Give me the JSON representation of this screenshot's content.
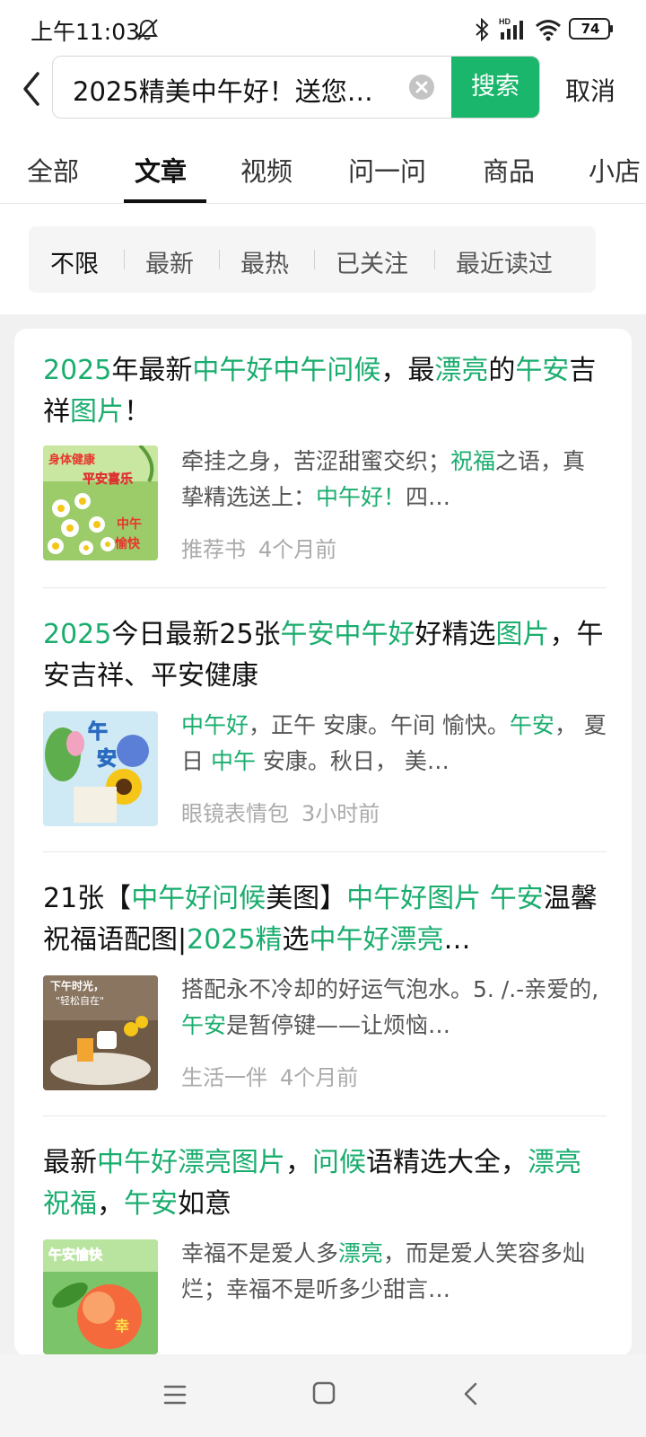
{
  "status_bar": {
    "time": "上午11:03",
    "network": "HD",
    "battery": "74"
  },
  "search": {
    "query": "2025精美中午好！送您…",
    "search_button": "搜索",
    "cancel": "取消"
  },
  "tabs": [
    {
      "label": "全部",
      "active": false
    },
    {
      "label": "文章",
      "active": true
    },
    {
      "label": "视频",
      "active": false
    },
    {
      "label": "问一问",
      "active": false
    },
    {
      "label": "商品",
      "active": false
    },
    {
      "label": "小店",
      "active": false
    }
  ],
  "filters": [
    {
      "label": "不限",
      "active": true
    },
    {
      "label": "最新",
      "active": false
    },
    {
      "label": "最热",
      "active": false
    },
    {
      "label": "已关注",
      "active": false
    },
    {
      "label": "最近读过",
      "active": false
    }
  ],
  "articles": [
    {
      "title": [
        {
          "t": "2025",
          "h": true
        },
        {
          "t": "年最新",
          "h": false
        },
        {
          "t": "中午好中午问候",
          "h": true
        },
        {
          "t": "，最",
          "h": false
        },
        {
          "t": "漂亮",
          "h": true
        },
        {
          "t": "的",
          "h": false
        },
        {
          "t": "午安",
          "h": true
        },
        {
          "t": "吉祥",
          "h": false
        },
        {
          "t": "图片",
          "h": true
        },
        {
          "t": "！",
          "h": false
        }
      ],
      "snippet": [
        {
          "t": "牵挂之身，苦涩甜蜜交织；",
          "h": false
        },
        {
          "t": "祝福",
          "h": true
        },
        {
          "t": "之语，真挚精选送上：",
          "h": false
        },
        {
          "t": "中午好！",
          "h": true
        },
        {
          "t": "四…",
          "h": false
        }
      ],
      "thumb_text": [
        "身体健康",
        "平安喜乐",
        "中午",
        "愉快"
      ],
      "source": "推荐书",
      "time": "4个月前"
    },
    {
      "title": [
        {
          "t": "2025",
          "h": true
        },
        {
          "t": "今日最新25张",
          "h": false
        },
        {
          "t": "午安中午好",
          "h": true
        },
        {
          "t": "好精选",
          "h": false
        },
        {
          "t": "图片",
          "h": true
        },
        {
          "t": "，午安吉祥、平安健康",
          "h": false
        }
      ],
      "snippet": [
        {
          "t": "中午好",
          "h": true
        },
        {
          "t": "，正午 安康。午间 愉快。",
          "h": false
        },
        {
          "t": "午安",
          "h": true
        },
        {
          "t": "， 夏日 ",
          "h": false
        },
        {
          "t": "中午",
          "h": true
        },
        {
          "t": " 安康。秋日， 美…",
          "h": false
        }
      ],
      "thumb_text": [
        "午",
        "安"
      ],
      "source": "眼镜表情包",
      "time": "3小时前"
    },
    {
      "title": [
        {
          "t": "21张【",
          "h": false
        },
        {
          "t": "中午好问候",
          "h": true
        },
        {
          "t": "美图】",
          "h": false
        },
        {
          "t": "中午好图片 午安",
          "h": true
        },
        {
          "t": "温馨祝福语配图|",
          "h": false
        },
        {
          "t": "2025精",
          "h": true
        },
        {
          "t": "选",
          "h": false
        },
        {
          "t": "中午好漂亮",
          "h": true
        },
        {
          "t": "…",
          "h": false
        }
      ],
      "snippet": [
        {
          "t": "搭配永不冷却的好运气泡水。5. /.-亲爱的,",
          "h": false
        },
        {
          "t": "午安",
          "h": true
        },
        {
          "t": "是暂停键——让烦恼…",
          "h": false
        }
      ],
      "thumb_text": [
        "下午时光，",
        "\"轻松自在\""
      ],
      "source": "生活一伴",
      "time": "4个月前"
    },
    {
      "title": [
        {
          "t": "最新",
          "h": false
        },
        {
          "t": "中午好漂亮图片",
          "h": true
        },
        {
          "t": "，",
          "h": false
        },
        {
          "t": "问候",
          "h": true
        },
        {
          "t": "语精选大全，",
          "h": false
        },
        {
          "t": "漂亮祝福",
          "h": true
        },
        {
          "t": "，",
          "h": false
        },
        {
          "t": "午安",
          "h": true
        },
        {
          "t": "如意",
          "h": false
        }
      ],
      "snippet": [
        {
          "t": "幸福不是爱人多",
          "h": false
        },
        {
          "t": "漂亮",
          "h": true
        },
        {
          "t": "，而是爱人笑容多灿烂；幸福不是听多少甜言…",
          "h": false
        }
      ],
      "thumb_text": [
        "午安愉快",
        "幸"
      ],
      "source": "",
      "time": ""
    }
  ],
  "nav": {
    "icons": [
      "menu-icon",
      "home-icon",
      "back-icon"
    ]
  }
}
